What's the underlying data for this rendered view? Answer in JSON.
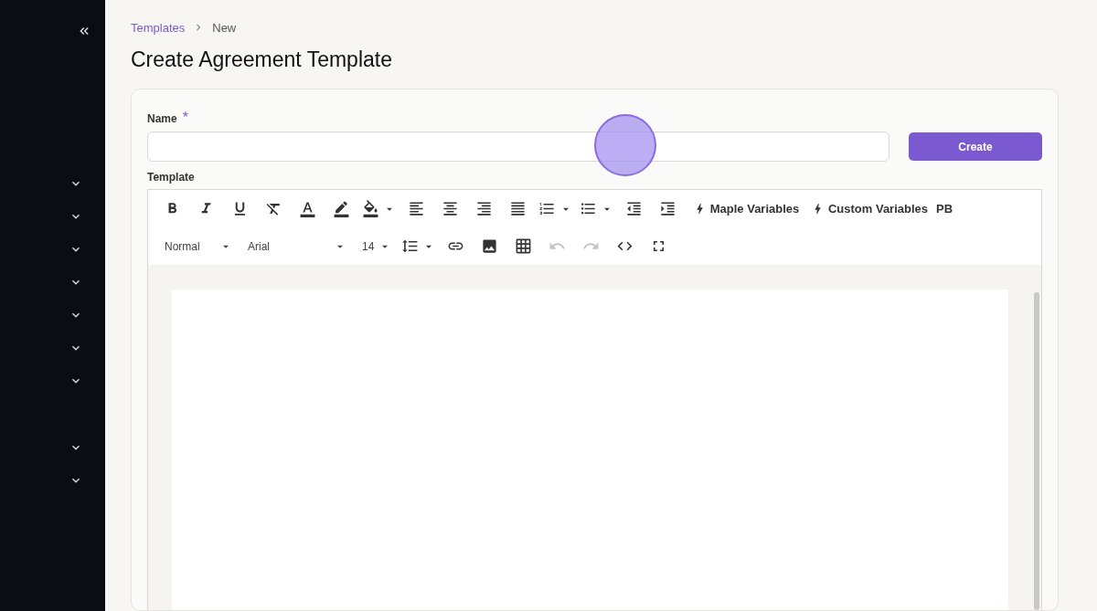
{
  "sidebar": {
    "groups": [
      {
        "items": [
          {
            "expanded": false
          },
          {
            "expanded": false
          },
          {
            "expanded": false
          },
          {
            "expanded": false
          },
          {
            "expanded": false
          },
          {
            "expanded": false
          },
          {
            "expanded": false
          }
        ]
      },
      {
        "items": [
          {
            "expanded": false
          },
          {
            "expanded": false
          }
        ]
      }
    ]
  },
  "breadcrumb": [
    {
      "label": "Templates",
      "kind": "link"
    },
    {
      "label": "New",
      "kind": "current"
    }
  ],
  "page_title": "Create Agreement Template",
  "name_field": {
    "label": "Name",
    "required": true,
    "required_mark": "*"
  },
  "create_button": "Create",
  "template_label": "Template",
  "toolbar": {
    "font_style": "Normal",
    "font_family": "Arial",
    "font_size": "14",
    "variable_buttons": [
      "Maple Variables",
      "Custom Variables"
    ],
    "pb_button": "PB",
    "undo": {
      "disabled": true
    },
    "redo": {
      "disabled": true
    }
  }
}
